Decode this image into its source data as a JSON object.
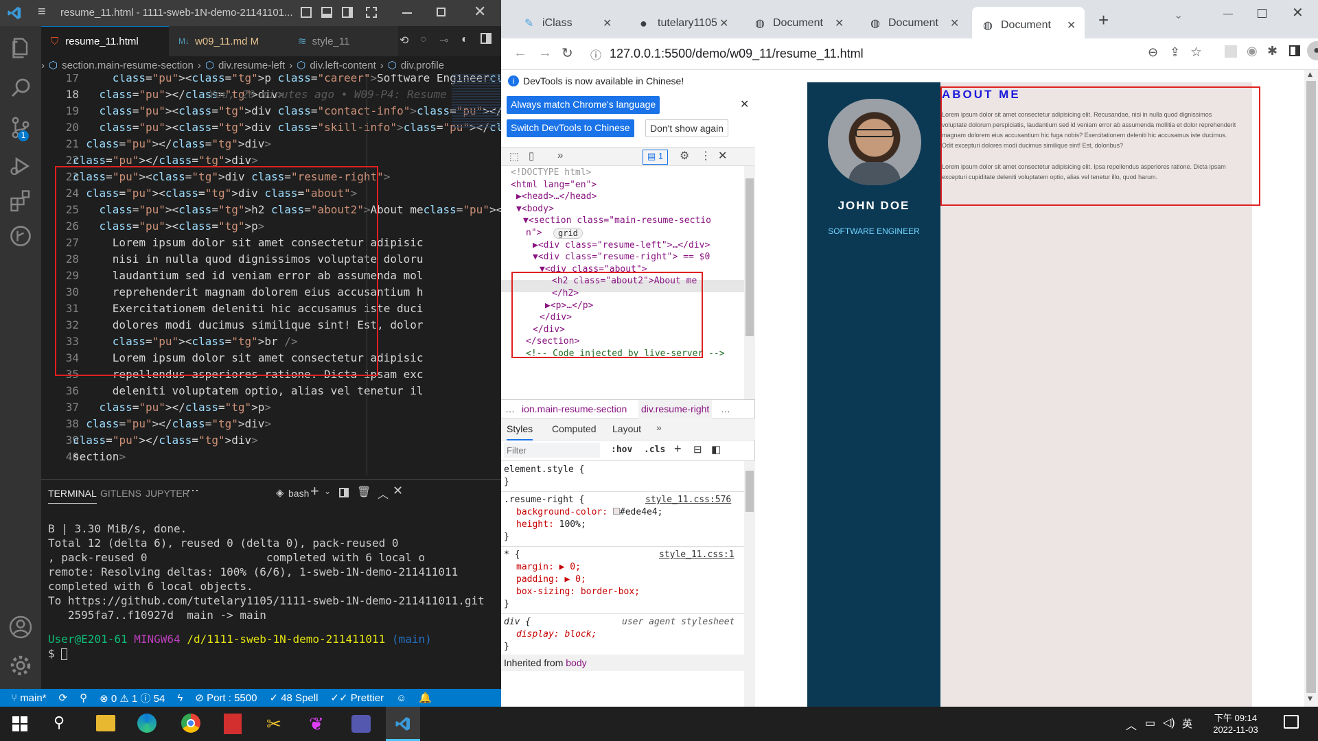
{
  "vscode": {
    "window_title": "resume_11.html - 1111-sweb-1N-demo-21141101...",
    "tabs": [
      {
        "label": "resume_11.html",
        "icon": "html-file-icon"
      },
      {
        "label": "w09_11.md M",
        "icon": "markdown-file-icon"
      },
      {
        "label": "style_11",
        "icon": "css-file-icon"
      }
    ],
    "breadcrumb": [
      "section.main-resume-section",
      "div.resume-left",
      "div.left-content",
      "div.profile"
    ],
    "code_lines": [
      {
        "n": "17",
        "t": "      <p class=\"career\">Software Engineer</p>"
      },
      {
        "n": "18",
        "t": "    </div>",
        "blame": "You, 20 minutes ago • W09-P4: Resume"
      },
      {
        "n": "19",
        "t": "    <div class=\"contact-info\"></div>"
      },
      {
        "n": "20",
        "t": "    <div class=\"skill-info\"></div>"
      },
      {
        "n": "21",
        "t": "  </div>"
      },
      {
        "n": "22",
        "t": "</div>"
      },
      {
        "n": "23",
        "t": "<div class=\"resume-right\">"
      },
      {
        "n": "24",
        "t": "  <div class=\"about\">"
      },
      {
        "n": "25",
        "t": "    <h2 class=\"about2\">About me</h2>"
      },
      {
        "n": "26",
        "t": "    <p>"
      },
      {
        "n": "27",
        "t": "      Lorem ipsum dolor sit amet consectetur adipisic"
      },
      {
        "n": "28",
        "t": "      nisi in nulla quod dignissimos voluptate doloru"
      },
      {
        "n": "29",
        "t": "      laudantium sed id veniam error ab assumenda mol"
      },
      {
        "n": "30",
        "t": "      reprehenderit magnam dolorem eius accusantium h"
      },
      {
        "n": "31",
        "t": "      Exercitationem deleniti hic accusamus iste duci"
      },
      {
        "n": "32",
        "t": "      dolores modi ducimus similique sint! Est, dolor"
      },
      {
        "n": "33",
        "t": "      <br />"
      },
      {
        "n": "34",
        "t": "      Lorem ipsum dolor sit amet consectetur adipisic"
      },
      {
        "n": "35",
        "t": "      repellendus asperiores ratione. Dicta ipsam exc"
      },
      {
        "n": "36",
        "t": "      deleniti voluptatem optio, alias vel tenetur il"
      },
      {
        "n": "37",
        "t": "    </p>"
      },
      {
        "n": "38",
        "t": "  </div>"
      },
      {
        "n": "39",
        "t": "</div>"
      },
      {
        "n": "40",
        "t": "section>"
      }
    ],
    "panel_tabs": [
      "TERMINAL",
      "GITLENS",
      "JUPYTER"
    ],
    "shell": "bash",
    "terminal_lines": [
      "B | 3.30 MiB/s, done.",
      "Total 12 (delta 6), reused 0 (delta 0), pack-reused 0",
      ", pack-reused 0                  completed with 6 local o",
      "remote: Resolving deltas: 100% (6/6), 1-sweb-1N-demo-211411011",
      "completed with 6 local objects.",
      "To https://github.com/tutelary1105/1111-sweb-1N-demo-211411011.git",
      "   2595fa7..f10927d  main -> main"
    ],
    "prompt_user": "User@E201-61",
    "prompt_env": "MINGW64",
    "prompt_path": "/d/1111-sweb-1N-demo-211411011",
    "prompt_branch": "(main)",
    "prompt_symbol": "$",
    "status": {
      "branch": "main*",
      "problems": "⊗ 0 ⚠ 1 ⓘ 54",
      "port": "Port : 5500",
      "spell": "48 Spell",
      "prettier": "Prettier"
    },
    "scm_badge": "1"
  },
  "chrome": {
    "tabs": [
      "iClass",
      "tutelary1105",
      "Document",
      "Document",
      "Document"
    ],
    "url": "127.0.0.1:5500/demo/w09_11/resume_11.html",
    "devtools": {
      "notice": "DevTools is now available in Chinese!",
      "btn_match": "Always match Chrome's language",
      "btn_switch": "Switch DevTools to Chinese",
      "btn_dont": "Don't show again",
      "issues_count": "1",
      "dom": [
        "<!DOCTYPE html>",
        "<html lang=\"en\">",
        "▶<head>…</head>",
        "▼<body>",
        "▼<section class=\"main-resume-sectio",
        "n\">",
        "▶<div class=\"resume-left\">…</div>",
        "▼<div class=\"resume-right\"> == $0",
        "▼<div class=\"about\">",
        "<h2 class=\"about2\">About me",
        "</h2>",
        "▶<p>…</p>",
        "</div>",
        "</div>",
        "</section>",
        "<!-- Code injected by live-server -->"
      ],
      "grid_badge": "grid",
      "crumbs": [
        "…",
        "ion.main-resume-section",
        "div.resume-right",
        "…"
      ],
      "style_tabs": [
        "Styles",
        "Computed",
        "Layout"
      ],
      "filter_placeholder": "Filter",
      "hov": ":hov",
      "cls": ".cls",
      "rules": {
        "element_style": "element.style {",
        "close": "}",
        "resume_selector": ".resume-right {",
        "resume_src": "style_11.css:576",
        "bg_prop": "background-color:",
        "bg_val": "#ede4e4;",
        "height_prop": "height:",
        "height_val": "100%;",
        "star_selector": "* {",
        "star_src": "style_11.css:1",
        "margin": "margin: ▶ 0;",
        "padding": "padding: ▶ 0;",
        "boxsizing": "box-sizing: border-box;",
        "div_selector": "div {",
        "ua": "user agent stylesheet",
        "display": "display: block;",
        "inherited": "Inherited from",
        "inherited_el": "body"
      }
    },
    "page": {
      "name": "JOHN DOE",
      "career": "SOFTWARE ENGINEER",
      "about_title": "ABOUT ME",
      "para1": "Lorem ipsum dolor sit amet consectetur adipisicing elit. Recusandae, nisi in nulla quod dignissimos voluptate dolorum perspiciatis, laudantium sed id veniam error ab assumenda mollitia et dolor reprehenderit magnam dolorem eius accusantium hic fuga nobis? Exercitationem deleniti hic accusamus iste ducimus. Odit excepturi dolores modi ducimus similique sint! Est, doloribus?",
      "para2": "Lorem ipsum dolor sit amet consectetur adipisicing elit. Ipsa repellendus asperiores ratione. Dicta ipsam excepturi cupiditate deleniti voluptatem optio, alias vel tenetur illo, quod harum."
    }
  },
  "taskbar": {
    "time": "下午 09:14",
    "date": "2022-11-03",
    "ime": "英"
  },
  "colors": {
    "vscode_accent": "#007acc",
    "sidebar_dark": "#0b3954",
    "about_bg": "#ede4e4",
    "about_title": "#1a1adb"
  }
}
